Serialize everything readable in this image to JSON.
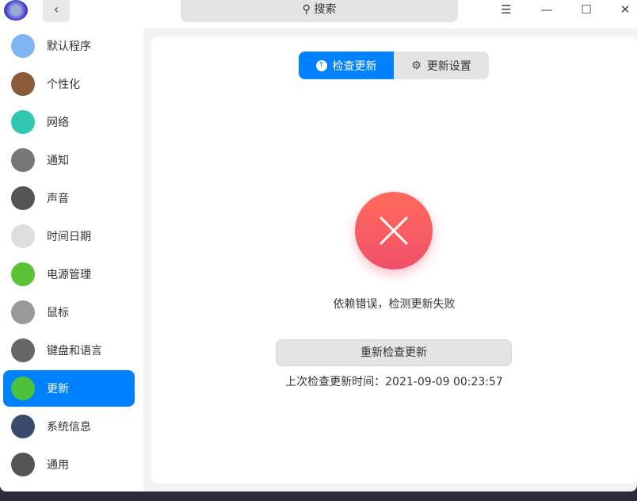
{
  "titlebar": {
    "search_label": "搜索"
  },
  "sidebar": {
    "items": [
      {
        "label": "默认程序",
        "color": "#7fb5f0"
      },
      {
        "label": "个性化",
        "color": "#8a5a3a"
      },
      {
        "label": "网络",
        "color": "#2fc7b0"
      },
      {
        "label": "通知",
        "color": "#777777"
      },
      {
        "label": "声音",
        "color": "#555555"
      },
      {
        "label": "时间日期",
        "color": "#dddddd"
      },
      {
        "label": "电源管理",
        "color": "#5bc236"
      },
      {
        "label": "鼠标",
        "color": "#999999"
      },
      {
        "label": "键盘和语言",
        "color": "#666666"
      },
      {
        "label": "更新",
        "color": "#4cc23a"
      },
      {
        "label": "系统信息",
        "color": "#3a4a6a"
      },
      {
        "label": "通用",
        "color": "#555555"
      }
    ],
    "active": "更新"
  },
  "main": {
    "tabs": [
      {
        "label": "检查更新"
      },
      {
        "label": "更新设置"
      }
    ],
    "error_message": "依赖错误，检测更新失败",
    "retry_label": "重新检查更新",
    "last_check": "上次检查更新时间：2021-09-09 00:23:57"
  }
}
